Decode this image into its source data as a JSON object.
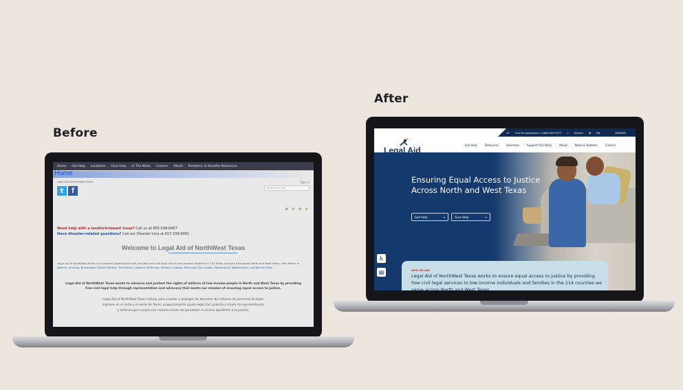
{
  "labels": {
    "before": "Before",
    "after": "After"
  },
  "before": {
    "nav": [
      "Home",
      "Get Help",
      "Locations",
      "Give Help",
      "In The News",
      "Careers",
      "About",
      "Pandemic & Disaster Resources"
    ],
    "home_heading": "Home",
    "org_small": "Legal Aid of NorthWest Texas",
    "signin": "Sign in",
    "search_placeholder": "Search this site",
    "line1_bold": "Need help with a landlord-tenant issue?",
    "line1_rest": "Call us at 855-548-8457",
    "line2_bold": "Have disaster-related questions?",
    "line2_rest": "Call our Disaster Line at 817-339-6391",
    "welcome": "Welcome to Legal Aid of NorthWest Texas",
    "intro_a": "Legal Aid of NorthWest Texas is a nonprofit organization that provides free civil legal help to low-income residents in 114 Texas counties throughout North and West Texas, with offices in",
    "intro_cities": "Abilene, Amarillo, Brownwood, Dallas, Denton, Fort Worth, Lubbock, McKinney, Midland, Odessa, Plainview, San Angelo, Waxahachie, Weatherford, and Wichita Falls.",
    "mission_1": "Legal Aid of NorthWest Texas works to advance and protect the rights of millions of low-income people in North and West Texas by providing",
    "mission_2": "free civil legal help through representation and advocacy that meets our mission of ensuring equal access to justice.",
    "es_1": "Legal Aid of NorthWest Texas trabaja para avanzar y proteger los derechos de millones de personas de bajos",
    "es_2": "ingresos en el norte y el oeste de Texas, proporcionando ayuda legal civil gratuita a través de representación",
    "es_3": "y defensa que cumple con nuestra misión de garantizar el acceso igualitario a la justicia."
  },
  "after": {
    "utility": [
      "Call for assistance: 1-888-529-5277",
      "Search",
      "EN",
      "DONATE"
    ],
    "logo": "Legal Aid",
    "logo_tag": "of NorthWest Texas",
    "nav": [
      "Get Help",
      "Resources",
      "Volunteer",
      "Support Our Work",
      "About",
      "News & Updates",
      "Careers"
    ],
    "hero_heading": "Ensuring Equal Access to Justice Across North and West Texas",
    "btn_get_help": "Get Help",
    "btn_give_help": "Give Help",
    "who_kicker": "WHO WE ARE",
    "who_text": "Legal Aid of NorthWest Texas works to ensure equal access to justice by providing free civil legal services to low-income individuals and families in the 114 counties we serve across North and West Texas."
  }
}
